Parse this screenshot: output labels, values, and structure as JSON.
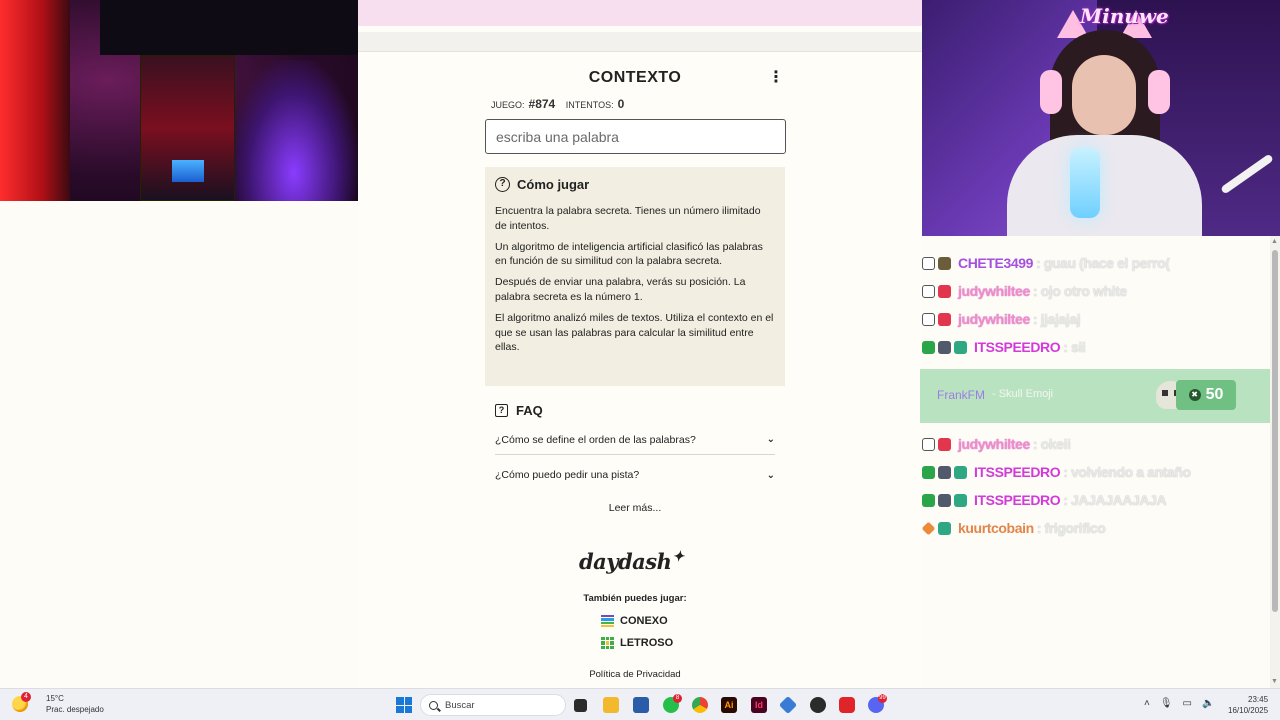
{
  "game": {
    "title": "CONTEXTO",
    "stats": {
      "game_label": "JUEGO:",
      "game_value": "#874",
      "attempts_label": "INTENTOS:",
      "attempts_value": "0"
    },
    "input_placeholder": "escriba una palabra",
    "howto": {
      "title": "Cómo jugar",
      "paragraphs": [
        "Encuentra la palabra secreta. Tienes un número ilimitado de intentos.",
        "Un algoritmo de inteligencia artificial clasificó las palabras en función de su similitud con la palabra secreta.",
        "Después de enviar una palabra, verás su posición. La palabra secreta es la número 1.",
        "El algoritmo analizó miles de textos. Utiliza el contexto en el que se usan las palabras para calcular la similitud entre ellas."
      ]
    },
    "faq": {
      "title": "FAQ",
      "items": [
        "¿Cómo se define el orden de las palabras?",
        "¿Cómo puedo pedir una pista?"
      ],
      "more": "Leer más..."
    },
    "brand": "daydash",
    "also_play": "También puedes jugar:",
    "other_games": [
      "CONEXO",
      "LETROSO"
    ],
    "privacy": "Política de Privacidad"
  },
  "stream": {
    "logo": "Minuwe"
  },
  "chat": {
    "messages": [
      {
        "user": "CHETE3499",
        "text": ": guau (hace el perro(",
        "color": "purple"
      },
      {
        "user": "judywhiltee",
        "text": ": ojo otro white",
        "color": "pink"
      },
      {
        "user": "judywhiltee",
        "text": ": jjajajaj",
        "color": "pink"
      },
      {
        "user": "ITSSPEEDRO",
        "text": ": sii",
        "color": "magenta"
      },
      {
        "user": "judywhiltee",
        "text": ": okeii",
        "color": "pink"
      },
      {
        "user": "ITSSPEEDRO",
        "text": ": volviendo a antaño",
        "color": "magenta"
      },
      {
        "user": "ITSSPEEDRO",
        "text": ": JAJAJAAJAJA",
        "color": "magenta"
      },
      {
        "user": "kuurtcobain",
        "text": ": frigorifico",
        "color": "orange"
      }
    ],
    "donation": {
      "user": "FrankFM",
      "desc": "- Skull Emoji",
      "amount": "50"
    }
  },
  "taskbar": {
    "weather_temp": "15°C",
    "weather_desc": "Prac. despejado",
    "weather_badge": "4",
    "search_placeholder": "Buscar",
    "whatsapp_badge": "8",
    "discord_badge": "99",
    "time": "23:45",
    "date": "16/10/2025"
  },
  "colors": {
    "pink_bar": "#f8dff0",
    "howto_bg": "#f2eee1",
    "donation_bg": "#b9e3c0",
    "user_purple": "#a450e0",
    "user_pink": "#ef8ccf",
    "user_magenta": "#d23bd9",
    "user_orange": "#e2854a"
  }
}
